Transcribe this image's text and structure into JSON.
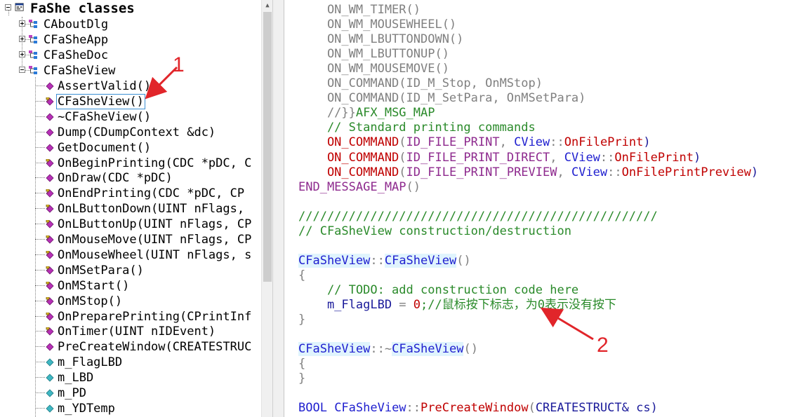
{
  "tree": {
    "root_label": "FaShe classes",
    "classes": [
      {
        "label": "CAboutDlg",
        "expanded": false
      },
      {
        "label": "CFaSheApp",
        "expanded": false
      },
      {
        "label": "CFaSheDoc",
        "expanded": false
      },
      {
        "label": "CFaSheView",
        "expanded": true
      }
    ],
    "members": [
      {
        "label": "AssertValid()",
        "icon": "method-icon",
        "selected": false
      },
      {
        "label": "CFaSheView()",
        "icon": "protected-method-icon",
        "selected": true
      },
      {
        "label": "~CFaSheView()",
        "icon": "method-icon",
        "selected": false
      },
      {
        "label": "Dump(CDumpContext &dc)",
        "icon": "method-icon",
        "selected": false
      },
      {
        "label": "GetDocument()",
        "icon": "method-icon",
        "selected": false
      },
      {
        "label": "OnBeginPrinting(CDC *pDC, C",
        "icon": "protected-method-icon",
        "selected": false
      },
      {
        "label": "OnDraw(CDC *pDC)",
        "icon": "method-icon",
        "selected": false
      },
      {
        "label": "OnEndPrinting(CDC *pDC, CP",
        "icon": "protected-method-icon",
        "selected": false
      },
      {
        "label": "OnLButtonDown(UINT nFlags, ",
        "icon": "protected-method-icon",
        "selected": false
      },
      {
        "label": "OnLButtonUp(UINT nFlags, CP",
        "icon": "protected-method-icon",
        "selected": false
      },
      {
        "label": "OnMouseMove(UINT nFlags, CP",
        "icon": "protected-method-icon",
        "selected": false
      },
      {
        "label": "OnMouseWheel(UINT nFlags, s",
        "icon": "protected-method-icon",
        "selected": false
      },
      {
        "label": "OnMSetPara()",
        "icon": "protected-method-icon",
        "selected": false
      },
      {
        "label": "OnMStart()",
        "icon": "protected-method-icon",
        "selected": false
      },
      {
        "label": "OnMStop()",
        "icon": "protected-method-icon",
        "selected": false
      },
      {
        "label": "OnPreparePrinting(CPrintInf",
        "icon": "protected-method-icon",
        "selected": false
      },
      {
        "label": "OnTimer(UINT nIDEvent)",
        "icon": "protected-method-icon",
        "selected": false
      },
      {
        "label": "PreCreateWindow(CREATESTRUC",
        "icon": "method-icon",
        "selected": false
      },
      {
        "label": "m_FlagLBD",
        "icon": "field-icon",
        "selected": false
      },
      {
        "label": "m_LBD",
        "icon": "field-icon",
        "selected": false
      },
      {
        "label": "m_PD",
        "icon": "field-icon",
        "selected": false
      },
      {
        "label": "m_YDTemp",
        "icon": "field-icon",
        "selected": false
      }
    ]
  },
  "code": {
    "lines": [
      [
        {
          "t": "    ON_WM_TIMER()",
          "c": "gray"
        }
      ],
      [
        {
          "t": "    ON_WM_MOUSEWHEEL()",
          "c": "gray"
        }
      ],
      [
        {
          "t": "    ON_WM_LBUTTONDOWN()",
          "c": "gray"
        }
      ],
      [
        {
          "t": "    ON_WM_LBUTTONUP()",
          "c": "gray"
        }
      ],
      [
        {
          "t": "    ON_WM_MOUSEMOVE()",
          "c": "gray"
        }
      ],
      [
        {
          "t": "    ON_COMMAND(ID_M_Stop, OnMStop)",
          "c": "gray"
        }
      ],
      [
        {
          "t": "    ON_COMMAND(ID_M_SetPara, OnMSetPara)",
          "c": "gray"
        }
      ],
      [
        {
          "t": "    //}}",
          "c": "gray"
        },
        {
          "t": "AFX_MSG_MAP",
          "c": "green"
        }
      ],
      [
        {
          "t": "    // Standard printing commands",
          "c": "green"
        }
      ],
      [
        {
          "t": "    ON_COMMAND",
          "c": "red"
        },
        {
          "t": "(",
          "c": "gray"
        },
        {
          "t": "ID_FILE_PRINT",
          "c": "purple"
        },
        {
          "t": ", ",
          "c": "gray"
        },
        {
          "t": "CView",
          "c": "blue"
        },
        {
          "t": "::",
          "c": "gray"
        },
        {
          "t": "OnFilePrint",
          "c": "red"
        },
        {
          "t": ")",
          "c": "navy"
        }
      ],
      [
        {
          "t": "    ON_COMMAND",
          "c": "red"
        },
        {
          "t": "(",
          "c": "gray"
        },
        {
          "t": "ID_FILE_PRINT_DIRECT",
          "c": "purple"
        },
        {
          "t": ", ",
          "c": "gray"
        },
        {
          "t": "CView",
          "c": "blue"
        },
        {
          "t": "::",
          "c": "gray"
        },
        {
          "t": "OnFilePrint",
          "c": "red"
        },
        {
          "t": ")",
          "c": "navy"
        }
      ],
      [
        {
          "t": "    ON_COMMAND",
          "c": "red"
        },
        {
          "t": "(",
          "c": "gray"
        },
        {
          "t": "ID_FILE_PRINT_PREVIEW",
          "c": "purple"
        },
        {
          "t": ", ",
          "c": "gray"
        },
        {
          "t": "CView",
          "c": "blue"
        },
        {
          "t": "::",
          "c": "gray"
        },
        {
          "t": "OnFilePrintPreview",
          "c": "red"
        },
        {
          "t": ")",
          "c": "navy"
        }
      ],
      [
        {
          "t": "END_MESSAGE_MAP",
          "c": "purple"
        },
        {
          "t": "()",
          "c": "gray"
        }
      ],
      [
        {
          "t": "",
          "c": ""
        }
      ],
      [
        {
          "t": "//////////////////////////////////////////////////",
          "c": "green"
        }
      ],
      [
        {
          "t": "// CFaSheView construction/destruction",
          "c": "green"
        }
      ],
      [
        {
          "t": "",
          "c": ""
        }
      ],
      [
        {
          "t": "CFaSheView",
          "c": "blue",
          "hl": true
        },
        {
          "t": "::",
          "c": "gray"
        },
        {
          "t": "CFaSheView",
          "c": "blue",
          "hl": true
        },
        {
          "t": "()",
          "c": "gray"
        }
      ],
      [
        {
          "t": "{",
          "c": "gray"
        }
      ],
      [
        {
          "t": "    // TODO: add construction code here",
          "c": "green"
        }
      ],
      [
        {
          "t": "    m_FlagLBD",
          "c": "navy"
        },
        {
          "t": " = ",
          "c": "gray"
        },
        {
          "t": "0",
          "c": "red"
        },
        {
          "t": ";//鼠标按下标志，为0表示没有按下",
          "c": "green"
        }
      ],
      [
        {
          "t": "}",
          "c": "gray"
        }
      ],
      [
        {
          "t": "",
          "c": ""
        }
      ],
      [
        {
          "t": "CFaSheView",
          "c": "blue",
          "hl": true
        },
        {
          "t": "::",
          "c": "gray"
        },
        {
          "t": "~",
          "c": "gray"
        },
        {
          "t": "CFaSheView",
          "c": "blue",
          "hl": true
        },
        {
          "t": "()",
          "c": "gray"
        }
      ],
      [
        {
          "t": "{",
          "c": "gray"
        }
      ],
      [
        {
          "t": "}",
          "c": "gray"
        }
      ],
      [
        {
          "t": "",
          "c": ""
        }
      ],
      [
        {
          "t": "BOOL ",
          "c": "blue"
        },
        {
          "t": "CFaSheView",
          "c": "blue"
        },
        {
          "t": "::",
          "c": "gray"
        },
        {
          "t": "PreCreateWindow",
          "c": "red"
        },
        {
          "t": "(",
          "c": "gray"
        },
        {
          "t": "CREATESTRUCT",
          "c": "navy"
        },
        {
          "t": "& cs)",
          "c": "navy"
        }
      ]
    ]
  },
  "annotations": {
    "label_1": "1",
    "label_2": "2",
    "arrow_color": "#e1252a"
  }
}
